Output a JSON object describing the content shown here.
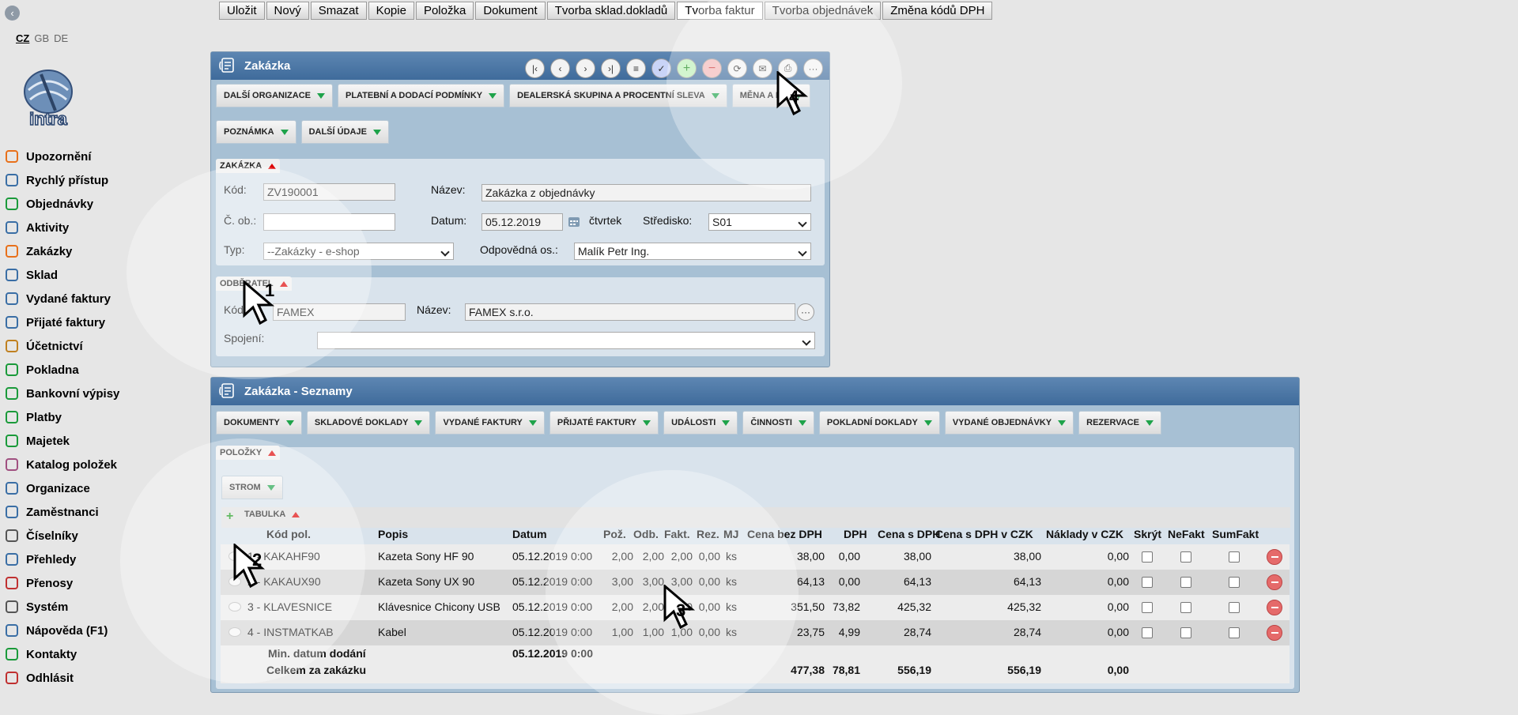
{
  "toolbar": [
    "Uložit",
    "Nový",
    "Smazat",
    "Kopie",
    "Položka",
    "Dokument",
    "Tvorba sklad.dokladů",
    "Tvorba faktur",
    "Tvorba objednávek",
    "Změna kódů DPH"
  ],
  "langs": {
    "cz": "CZ",
    "gb": "GB",
    "de": "DE"
  },
  "logo_text": "intra",
  "nav": [
    {
      "label": "Upozornění",
      "icon": "bell-icon"
    },
    {
      "label": "Rychlý přístup",
      "icon": "grid-icon"
    },
    {
      "label": "Objednávky",
      "icon": "cart-icon"
    },
    {
      "label": "Aktivity",
      "icon": "clock-icon"
    },
    {
      "label": "Zakázky",
      "icon": "order-icon"
    },
    {
      "label": "Sklad",
      "icon": "warehouse-icon"
    },
    {
      "label": "Vydané faktury",
      "icon": "invoice-out-icon"
    },
    {
      "label": "Přijaté faktury",
      "icon": "invoice-in-icon"
    },
    {
      "label": "Účetnictví",
      "icon": "ledger-icon"
    },
    {
      "label": "Pokladna",
      "icon": "cashbox-icon"
    },
    {
      "label": "Bankovní výpisy",
      "icon": "bank-icon"
    },
    {
      "label": "Platby",
      "icon": "payment-icon"
    },
    {
      "label": "Majetek",
      "icon": "asset-icon"
    },
    {
      "label": "Katalog položek",
      "icon": "catalog-icon"
    },
    {
      "label": "Organizace",
      "icon": "organization-icon"
    },
    {
      "label": "Zaměstnanci",
      "icon": "employees-icon"
    },
    {
      "label": "Číselníky",
      "icon": "gear-icon"
    },
    {
      "label": "Přehledy",
      "icon": "report-icon"
    },
    {
      "label": "Přenosy",
      "icon": "transfer-icon"
    },
    {
      "label": "Systém",
      "icon": "wrench-icon"
    },
    {
      "label": "Nápověda (F1)",
      "icon": "help-icon"
    },
    {
      "label": "Kontakty",
      "icon": "at-icon"
    },
    {
      "label": "Odhlásit",
      "icon": "power-icon"
    }
  ],
  "zakazka": {
    "title": "Zakázka",
    "tabs": [
      "DALŠÍ ORGANIZACE",
      "PLATEBNÍ A DODACÍ PODMÍNKY",
      "DEALERSKÁ SKUPINA A PROCENTNÍ SLEVA",
      "MĚNA A KU"
    ],
    "tabs2": [
      "POZNÁMKA",
      "DALŠÍ ÚDAJE"
    ],
    "section": "ZAKÁZKA",
    "kod_label": "Kód:",
    "kod": "ZV190001",
    "nazev_label": "Název:",
    "nazev": "Zakázka z objednávky",
    "cob_label": "Č. ob.:",
    "cob": "",
    "datum_label": "Datum:",
    "datum": "05.12.2019",
    "den": "čtvrtek",
    "stredisko_label": "Středisko:",
    "stredisko": "S01",
    "typ_label": "Typ:",
    "typ": "--Zakázky - e-shop",
    "odp_label": "Odpovědná os.:",
    "odp": "Malík Petr Ing.",
    "odb_section": "ODBĚRATEL",
    "odb_kod_label": "Kód:",
    "odb_kod": "FAMEX",
    "odb_nazev_label": "Název:",
    "odb_nazev": "FAMEX s.r.o.",
    "spojeni_label": "Spojení:",
    "spojeni": ""
  },
  "seznamy": {
    "title": "Zakázka - Seznamy",
    "tabs": [
      "DOKUMENTY",
      "SKLADOVÉ DOKLADY",
      "VYDANÉ FAKTURY",
      "PŘIJATÉ FAKTURY",
      "UDÁLOSTI",
      "ČINNOSTI",
      "POKLADNÍ DOKLADY",
      "VYDANÉ OBJEDNÁVKY",
      "REZERVACE"
    ],
    "polozky": "POLOŽKY",
    "strom": "STROM",
    "tabulka": "TABULKA",
    "headers": [
      "Kód pol.",
      "Popis",
      "Datum",
      "Pož.",
      "Odb.",
      "Fakt.",
      "Rez.",
      "MJ",
      "Cena bez DPH",
      "DPH",
      "Cena s DPH",
      "Cena s DPH v CZK",
      "Náklady v CZK",
      "Skrýt",
      "NeFakt",
      "SumFakt"
    ],
    "rows": [
      {
        "kod": "1 - KAKAHF90",
        "popis": "Kazeta Sony HF 90",
        "datum": "05.12.2019 0:00",
        "poz": "2,00",
        "odb": "2,00",
        "fakt": "2,00",
        "rez": "0,00",
        "mj": "ks",
        "cena": "38,00",
        "dph": "0,00",
        "cenas": "38,00",
        "czk": "38,00",
        "naklady": "0,00"
      },
      {
        "kod": "2 - KAKAUX90",
        "popis": "Kazeta Sony UX 90",
        "datum": "05.12.2019 0:00",
        "poz": "3,00",
        "odb": "3,00",
        "fakt": "3,00",
        "rez": "0,00",
        "mj": "ks",
        "cena": "64,13",
        "dph": "0,00",
        "cenas": "64,13",
        "czk": "64,13",
        "naklady": "0,00"
      },
      {
        "kod": "3 - KLAVESNICE",
        "popis": "Klávesnice Chicony USB",
        "datum": "05.12.2019 0:00",
        "poz": "2,00",
        "odb": "2,00",
        "fakt": "2,00",
        "rez": "0,00",
        "mj": "ks",
        "cena": "351,50",
        "dph": "73,82",
        "cenas": "425,32",
        "czk": "425,32",
        "naklady": "0,00"
      },
      {
        "kod": "4 - INSTMATKAB",
        "popis": "Kabel",
        "datum": "05.12.2019 0:00",
        "poz": "1,00",
        "odb": "1,00",
        "fakt": "1,00",
        "rez": "0,00",
        "mj": "ks",
        "cena": "23,75",
        "dph": "4,99",
        "cenas": "28,74",
        "czk": "28,74",
        "naklady": "0,00"
      }
    ],
    "min_label": "Min. datum dodání",
    "min_value": "05.12.2019 0:00",
    "total_label": "Celkem za zakázku",
    "total_cena": "477,38",
    "total_dph": "78,81",
    "total_cenas": "556,19",
    "total_czk": "556,19",
    "total_naklady": "0,00"
  },
  "markers": [
    "1",
    "2",
    "3",
    "4"
  ]
}
